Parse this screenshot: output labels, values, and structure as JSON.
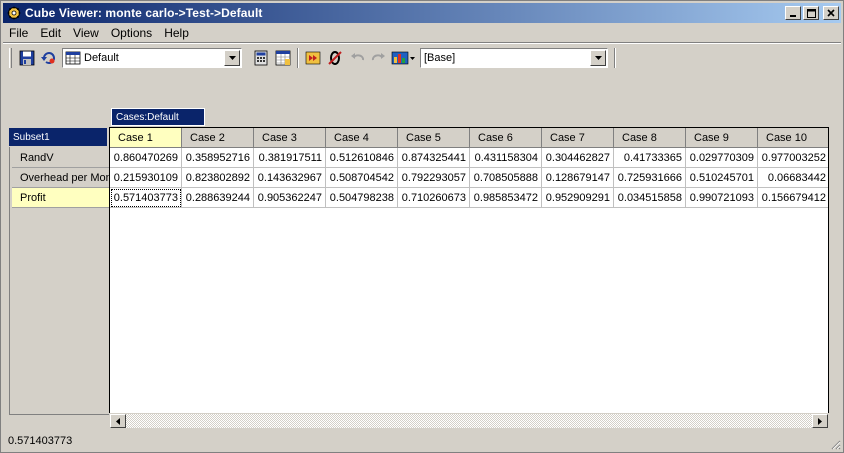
{
  "window": {
    "title": "Cube Viewer: monte carlo->Test->Default",
    "minimize": "_",
    "maximize": "□",
    "close": "✕"
  },
  "menu": [
    {
      "label": "File"
    },
    {
      "label": "Edit"
    },
    {
      "label": "View"
    },
    {
      "label": "Options"
    },
    {
      "label": "Help"
    }
  ],
  "toolbar": {
    "view_select": "Default",
    "subset_select": "[Base]"
  },
  "dimensions": {
    "column_tab": "Cases:Default",
    "row_subset": "Subset1"
  },
  "grid": {
    "columns": [
      "Case 1",
      "Case 2",
      "Case 3",
      "Case 4",
      "Case 5",
      "Case 6",
      "Case 7",
      "Case 8",
      "Case 9",
      "Case 10"
    ],
    "rows": [
      {
        "label": "RandV",
        "values": [
          "0.860470269",
          "0.358952716",
          "0.381917511",
          "0.512610846",
          "0.874325441",
          "0.431158304",
          "0.304462827",
          "0.41733365",
          "0.029770309",
          "0.977003252"
        ]
      },
      {
        "label": "Overhead per Mon",
        "values": [
          "0.215930109",
          "0.823802892",
          "0.143632967",
          "0.508704542",
          "0.792293057",
          "0.708505888",
          "0.128679147",
          "0.725931666",
          "0.510245701",
          "0.06683442"
        ]
      },
      {
        "label": "Profit",
        "values": [
          "0.571403773",
          "0.288639244",
          "0.905362247",
          "0.504798238",
          "0.710260673",
          "0.985853472",
          "0.952909291",
          "0.034515858",
          "0.990721093",
          "0.156679412"
        ]
      }
    ]
  },
  "status": {
    "text": "0.571403773"
  },
  "colors": {
    "title_bar": "#0a246a",
    "highlight": "#ffffc0",
    "face": "#d4d0c8"
  }
}
